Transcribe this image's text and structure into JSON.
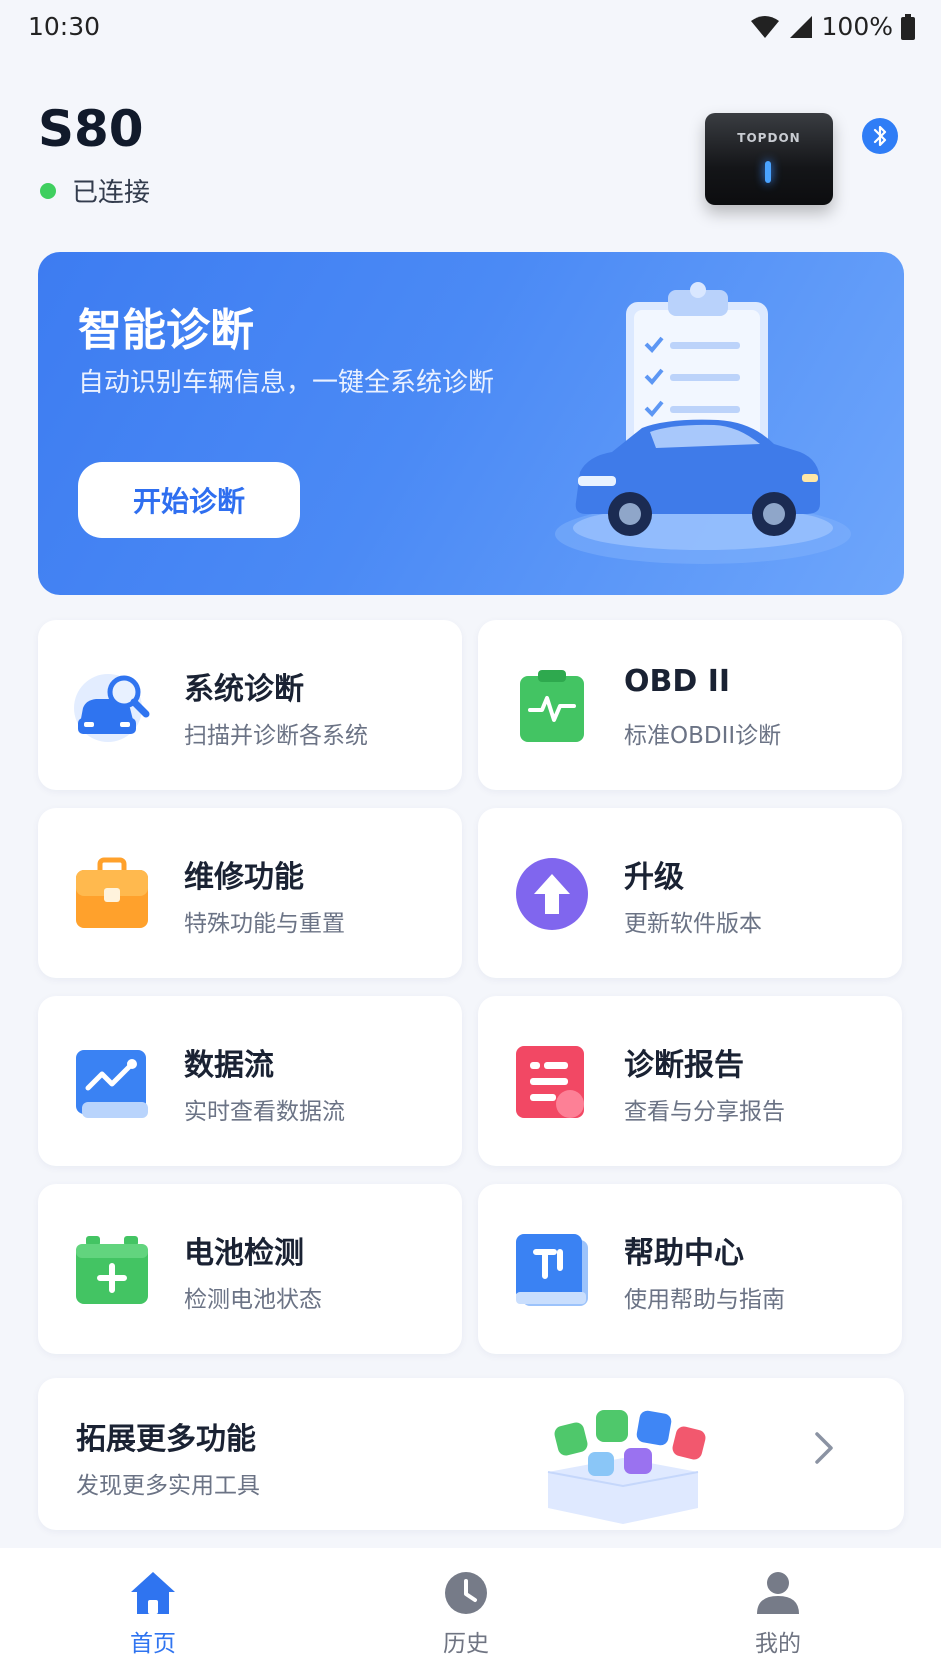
{
  "status_bar": {
    "time": "10:30",
    "battery": "100%"
  },
  "device": {
    "name": "S80",
    "status": "已连接",
    "brand": "TOPDON"
  },
  "hero": {
    "title": "智能诊断",
    "subtitle": "自动识别车辆信息，一键全系统诊断",
    "button": "开始诊断"
  },
  "features": [
    {
      "title": "系统诊断",
      "subtitle": "扫描并诊断各系统",
      "icon": "car-search-icon"
    },
    {
      "title": "OBD II",
      "subtitle": "标准OBDII诊断",
      "icon": "clipboard-pulse-icon"
    },
    {
      "title": "维修功能",
      "subtitle": "特殊功能与重置",
      "icon": "toolbox-icon"
    },
    {
      "title": "升级",
      "subtitle": "更新软件版本",
      "icon": "upgrade-arrow-icon"
    },
    {
      "title": "数据流",
      "subtitle": "实时查看数据流",
      "icon": "chart-trend-icon"
    },
    {
      "title": "诊断报告",
      "subtitle": "查看与分享报告",
      "icon": "report-icon"
    },
    {
      "title": "电池检测",
      "subtitle": "检测电池状态",
      "icon": "battery-icon"
    },
    {
      "title": "帮助中心",
      "subtitle": "使用帮助与指南",
      "icon": "help-book-icon"
    }
  ],
  "more": {
    "title": "拓展更多功能",
    "subtitle": "发现更多实用工具"
  },
  "tabs": [
    {
      "label": "首页",
      "icon": "home-icon",
      "active": true
    },
    {
      "label": "历史",
      "icon": "clock-icon",
      "active": false
    },
    {
      "label": "我的",
      "icon": "user-icon",
      "active": false
    }
  ],
  "colors": {
    "accent": "#2f74f0",
    "connected": "#3fcf5f",
    "background": "#f4f6fb"
  }
}
